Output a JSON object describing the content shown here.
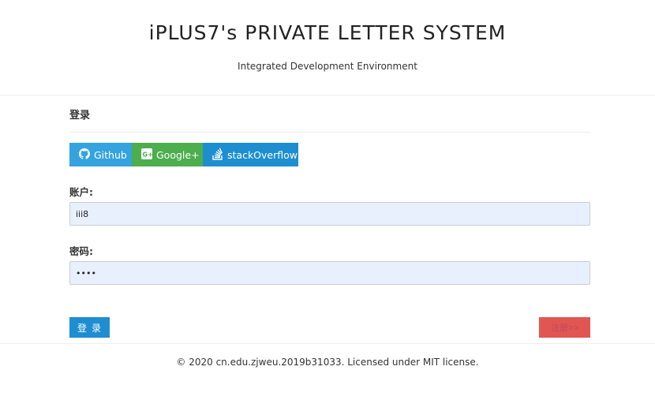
{
  "header": {
    "title": "iPLUS7's PRIVATE LETTER SYSTEM",
    "subtitle": "Integrated Development Environment"
  },
  "login": {
    "section_title": "登录",
    "oauth": [
      {
        "label": "Github",
        "icon": "github-icon",
        "color": "#34a3e0"
      },
      {
        "label": "Google+",
        "icon": "google-plus-icon",
        "color": "#4cae4c"
      },
      {
        "label": "stackOverflow",
        "icon": "stackoverflow-icon",
        "color": "#1d8fd0"
      }
    ],
    "account_label": "账户:",
    "account_value": "iii8",
    "password_label": "密码:",
    "password_value": "iiii",
    "login_button": "登录",
    "register_button": "注册>>"
  },
  "footer": {
    "text": "© 2020 cn.edu.zjweu.2019b31033. Licensed under MIT license."
  },
  "colors": {
    "login_button": "#1e8ed1",
    "register_button": "#e15652",
    "input_background": "#e8f0fe"
  }
}
